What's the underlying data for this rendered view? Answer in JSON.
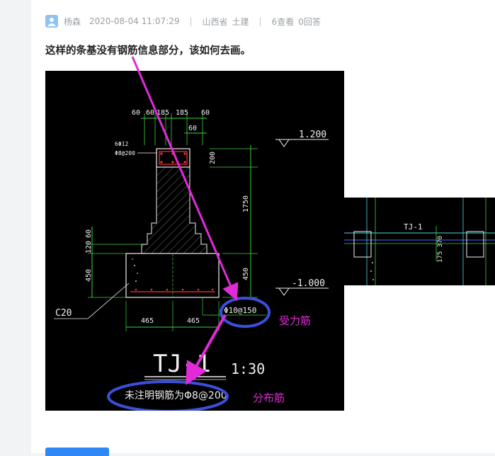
{
  "post": {
    "author": "杨森",
    "datetime": "2020-08-04 11:07:29",
    "separator": "|",
    "province": "山西省",
    "category": "土建",
    "views": "6查看",
    "answers": "0回答",
    "question": "这样的条基没有钢筋信息部分，该如何去画。"
  },
  "drawing": {
    "dims_top": [
      "60",
      "60",
      "185",
      "185",
      "60"
    ],
    "dim_mid": "60",
    "rebar_corner": "6Φ12",
    "stirrup": "Φ8@200",
    "dim_200": "200",
    "dim_1750": "1750",
    "dim_450_right": "450",
    "dim_120": "120",
    "dim_60_left": "60",
    "dim_450_left": "450",
    "elev_top": "1.200",
    "elev_bottom": "-1.000",
    "concrete": "C20",
    "dims_bottom": [
      "465",
      "465"
    ],
    "main_rebar": "Φ10@150",
    "title": "TJ-1",
    "scale": "1:30",
    "distribution_note": "未注明钢筋为Φ8@200",
    "annotation_main": "受力筋",
    "annotation_dist": "分布筋"
  },
  "inset": {
    "label": "TJ-1",
    "dims": "175 370"
  },
  "colors": {
    "annotation_magenta": "#e02bd6",
    "circle_blue": "#3b4fd8",
    "cad_green": "#3cd63c",
    "cad_white": "#f0f0f0",
    "cad_red": "#ff3030",
    "cad_cyan": "#4fd6e6"
  }
}
